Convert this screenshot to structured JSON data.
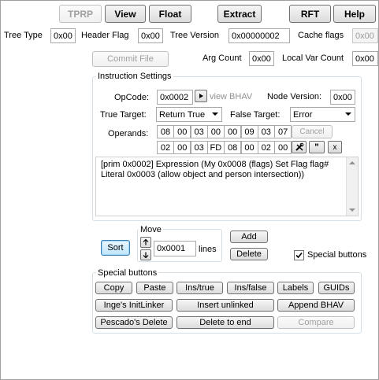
{
  "toolbar": {
    "tprp": "TPRP",
    "view": "View",
    "float": "Float",
    "extract": "Extract",
    "rft": "RFT",
    "help": "Help"
  },
  "header": {
    "tree_type_label": "Tree Type",
    "tree_type_value": "0x00",
    "header_flag_label": "Header Flag",
    "header_flag_value": "0x00",
    "tree_version_label": "Tree Version",
    "tree_version_value": "0x00000002",
    "cache_flags_label": "Cache flags",
    "cache_flags_value": "0x00",
    "commit_file": "Commit File",
    "arg_count_label": "Arg Count",
    "arg_count_value": "0x00",
    "local_var_label": "Local Var Count",
    "local_var_value": "0x00"
  },
  "instruction": {
    "group_title": "Instruction Settings",
    "opcode_label": "OpCode:",
    "opcode_value": "0x0002",
    "view_bhav": "view BHAV",
    "node_version_label": "Node Version:",
    "node_version_value": "0x00",
    "true_target_label": "True Target:",
    "true_target_value": "Return True",
    "false_target_label": "False Target:",
    "false_target_value": "Error",
    "operands_label": "Operands:",
    "operands_row1": [
      "08",
      "00",
      "03",
      "00",
      "00",
      "09",
      "03",
      "07"
    ],
    "operands_row2": [
      "02",
      "00",
      "03",
      "FD",
      "08",
      "00",
      "02",
      "00"
    ],
    "cancel": "Cancel",
    "quote_btn": "\"",
    "x_btn": "x",
    "description": "[prim 0x0002] Expression (My 0x0008 (flags) Set Flag flag# Literal 0x0003 (allow object and person intersection))"
  },
  "move": {
    "sort": "Sort",
    "label": "Move",
    "value": "0x0001",
    "lines": "lines",
    "add": "Add",
    "delete": "Delete",
    "special_buttons_check": "Special buttons",
    "checked": true
  },
  "special": {
    "title": "Special buttons",
    "copy": "Copy",
    "paste": "Paste",
    "ins_true": "Ins/true",
    "ins_false": "Ins/false",
    "labels": "Labels",
    "guids": "GUIDs",
    "inge": "Inge's InitLinker",
    "insert_unlinked": "Insert unlinked",
    "append_bhav": "Append BHAV",
    "pescado": "Pescado's Delete",
    "delete_to_end": "Delete to end",
    "compare": "Compare"
  }
}
